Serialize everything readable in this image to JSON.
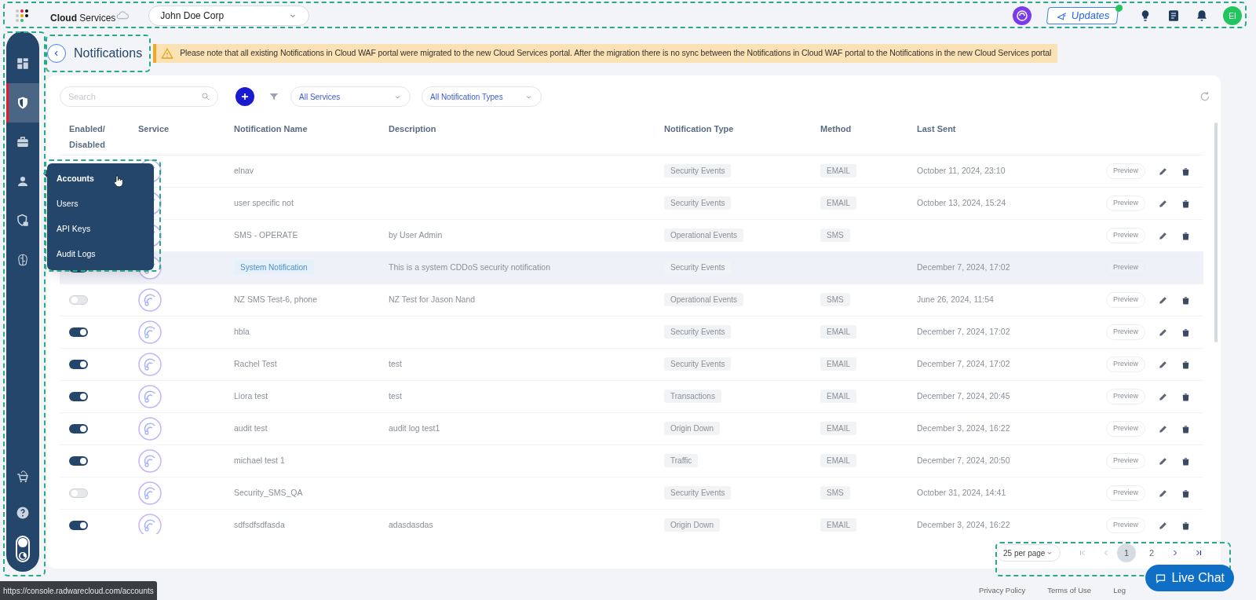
{
  "topbar": {
    "brand": "**Cloud** Services",
    "org_select": "John Doe Corp",
    "updates_button": "Updates",
    "updates_new": true,
    "avatar": "EI"
  },
  "sidebar": {
    "items": [
      {
        "selected": false
      },
      {
        "selected": true
      },
      {
        "selected": false
      },
      {
        "selected": false
      },
      {
        "selected": false
      },
      {
        "selected": false
      }
    ],
    "bottom_items": [
      {
        "selected": false
      },
      {
        "selected": false
      }
    ],
    "dark_mode": false
  },
  "flyout_menu": {
    "items": [
      {
        "label": "Accounts",
        "selected": true
      },
      {
        "label": "Users",
        "selected": false
      },
      {
        "label": "API Keys",
        "selected": false
      },
      {
        "label": "Audit Logs",
        "selected": false
      }
    ]
  },
  "page_title": "Notifications",
  "banner": "Please note that all existing Notifications in Cloud WAF portal were migrated to the new Cloud Services portal. After the migration there is no sync between the Notifications in Cloud WAF portal to the Notifications in the new Cloud Services portal",
  "toolbar": {
    "search": {
      "placeholder": "Search"
    },
    "filters": [
      "All Services",
      "All Notification Types"
    ]
  },
  "table": {
    "columns": [
      "Enabled/ Disabled",
      "Service",
      "Notification Name",
      "Description",
      "Notification Type",
      "Method",
      "Last Sent"
    ],
    "rows": [
      {
        "kind": "user",
        "highlighted": false,
        "name": "elnav",
        "description": "",
        "type": "Security Events",
        "method": "EMAIL",
        "last_sent": "October 11, 2024, 23:10",
        "preview": "Preview"
      },
      {
        "kind": "user",
        "highlighted": false,
        "name": "user specific not",
        "description": "",
        "type": "Security Events",
        "method": "EMAIL",
        "last_sent": "October 13, 2024, 15:24",
        "preview": "Preview"
      },
      {
        "kind": "user",
        "highlighted": false,
        "name": "SMS - OPERATE",
        "description": "by User Admin",
        "type": "Operational Events",
        "method": "SMS",
        "last_sent": "",
        "preview": "Preview"
      },
      {
        "kind": "system",
        "highlighted": true,
        "enabled": true,
        "name": "System Notification",
        "description": "This is a system CDDoS security notification",
        "type": "Security Events",
        "method": "",
        "last_sent": "December 7, 2024, 17:02",
        "preview": "Preview"
      },
      {
        "kind": "user",
        "highlighted": false,
        "enabled": false,
        "name": "NZ SMS Test-6, phone",
        "description": "NZ Test for Jason Nand",
        "type": "Operational Events",
        "method": "SMS",
        "last_sent": "June 26, 2024, 11:54",
        "preview": "Preview"
      },
      {
        "kind": "user",
        "highlighted": false,
        "enabled": true,
        "name": "hbla",
        "description": "",
        "type": "Security Events",
        "method": "EMAIL",
        "last_sent": "December 7, 2024, 17:02",
        "preview": "Preview"
      },
      {
        "kind": "user",
        "highlighted": false,
        "enabled": true,
        "name": "Rachel Test",
        "description": "test",
        "type": "Security Events",
        "method": "EMAIL",
        "last_sent": "December 7, 2024, 17:02",
        "preview": "Preview"
      },
      {
        "kind": "user",
        "highlighted": false,
        "enabled": true,
        "name": "Liora test",
        "description": "test",
        "type": "Transactions",
        "method": "EMAIL",
        "last_sent": "December 7, 2024, 20:45",
        "preview": "Preview"
      },
      {
        "kind": "user",
        "highlighted": false,
        "enabled": true,
        "name": "audit test",
        "description": "audit log test1",
        "type": "Origin Down",
        "method": "EMAIL",
        "last_sent": "December 3, 2024, 16:22",
        "preview": "Preview"
      },
      {
        "kind": "user",
        "highlighted": false,
        "enabled": true,
        "name": "michael test 1",
        "description": "",
        "type": "Traffic",
        "method": "EMAIL",
        "last_sent": "December 7, 2024, 20:50",
        "preview": "Preview"
      },
      {
        "kind": "user",
        "highlighted": false,
        "enabled": false,
        "name": "Security_SMS_QA",
        "description": "",
        "type": "Security Events",
        "method": "SMS",
        "last_sent": "October 31, 2024, 14:41",
        "preview": "Preview"
      },
      {
        "kind": "user",
        "highlighted": false,
        "enabled": true,
        "name": "sdfsdfsdfasda",
        "description": "adasdasdas",
        "type": "Origin Down",
        "method": "EMAIL",
        "last_sent": "December 3, 2024, 16:22",
        "preview": "Preview"
      }
    ]
  },
  "pagination": {
    "per_page": "25 per page",
    "pages": [
      {
        "label": "1",
        "selected": true
      },
      {
        "label": "2",
        "selected": false
      }
    ],
    "prev_disabled": true,
    "next_disabled": false
  },
  "footer_links": [
    "Privacy Policy",
    "Terms of Use",
    "Leg"
  ],
  "live_chat": "Live Chat",
  "status_url": "https://console.radwarecloud.com/accounts"
}
